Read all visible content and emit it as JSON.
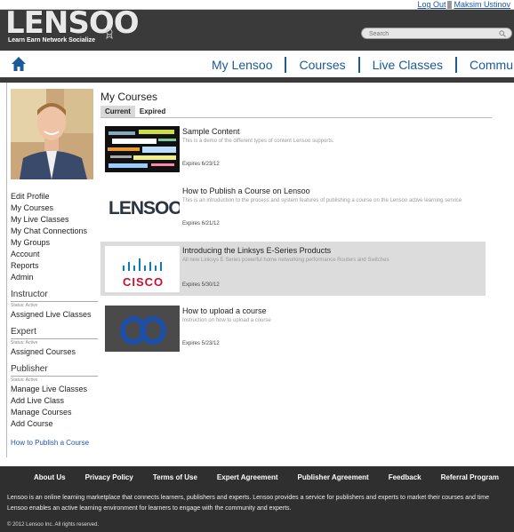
{
  "header": {
    "logout": "Log Out",
    "user_name": "Maksim Ustinov",
    "logo_text": "LENSOO",
    "tagline": "Learn Earn Network Socialize",
    "search_placeholder": "Search"
  },
  "nav": {
    "items": [
      {
        "label": "My Lensoo"
      },
      {
        "label": "Courses"
      },
      {
        "label": "Live Classes"
      },
      {
        "label": "Community"
      }
    ]
  },
  "sidebar": {
    "links": [
      {
        "label": "Edit Profile"
      },
      {
        "label": "My Courses"
      },
      {
        "label": "My Live Classes"
      },
      {
        "label": "My Chat Connections"
      },
      {
        "label": "My Groups"
      },
      {
        "label": "Account"
      },
      {
        "label": "Reports"
      },
      {
        "label": "Admin"
      }
    ],
    "instructor": {
      "title": "Instructor",
      "status": "Status: Active",
      "links": [
        {
          "label": "Assigned Live Classes"
        }
      ]
    },
    "expert": {
      "title": "Expert",
      "status": "Status: Active",
      "links": [
        {
          "label": "Assigned Courses"
        }
      ]
    },
    "publisher": {
      "title": "Publisher",
      "status": "Status: Active",
      "links": [
        {
          "label": "Manage Live Classes"
        },
        {
          "label": "Add Live Class"
        },
        {
          "label": "Manage Courses"
        },
        {
          "label": "Add Course"
        }
      ]
    },
    "howto": "How to Publish a Course"
  },
  "main": {
    "title": "My Courses",
    "tabs": [
      {
        "label": "Current"
      },
      {
        "label": "Expired"
      }
    ],
    "courses": [
      {
        "title": "Sample Content",
        "desc": "This is a demo of the different types of content Lensoo supports.",
        "expires": "Expires 6/23/12"
      },
      {
        "title": "How to Publish a Course on Lensoo",
        "desc": "This is an introduction to the process and system features of publishing a course on the Lensoo active learning service",
        "expires": "Expires 6/21/12"
      },
      {
        "title": "Introducing the Linksys E-Series Products",
        "desc": "All new Linksys E Series powerful home networking performance Routers and Switches",
        "expires": "Expires 5/30/12",
        "thumb_text": "CISCO"
      },
      {
        "title": "How to upload a course",
        "desc": "Instruction on how to upload a course",
        "expires": "Expires 5/23/12"
      }
    ],
    "thumb_logo": "LENSOO"
  },
  "footer": {
    "links": [
      {
        "label": "About Us"
      },
      {
        "label": "Privacy Policy"
      },
      {
        "label": "Terms of Use"
      },
      {
        "label": "Expert Agreement"
      },
      {
        "label": "Publisher Agreement"
      },
      {
        "label": "Feedback"
      },
      {
        "label": "Referral Program"
      }
    ],
    "desc_line1": "Lensoo is an online learning marketplace that connects learners, publishers and experts. Lensoo provides a service for publishers and experts to market their courses and time",
    "desc_line2": "Lensoo enables an active learning environment for learners to engage with the community and experts.",
    "copyright": "© 2012 Lensoo Inc. All rights reserved."
  },
  "colors": {
    "accent": "#1a5a99",
    "dark": "#3a3a3a",
    "link": "#2255aa"
  }
}
